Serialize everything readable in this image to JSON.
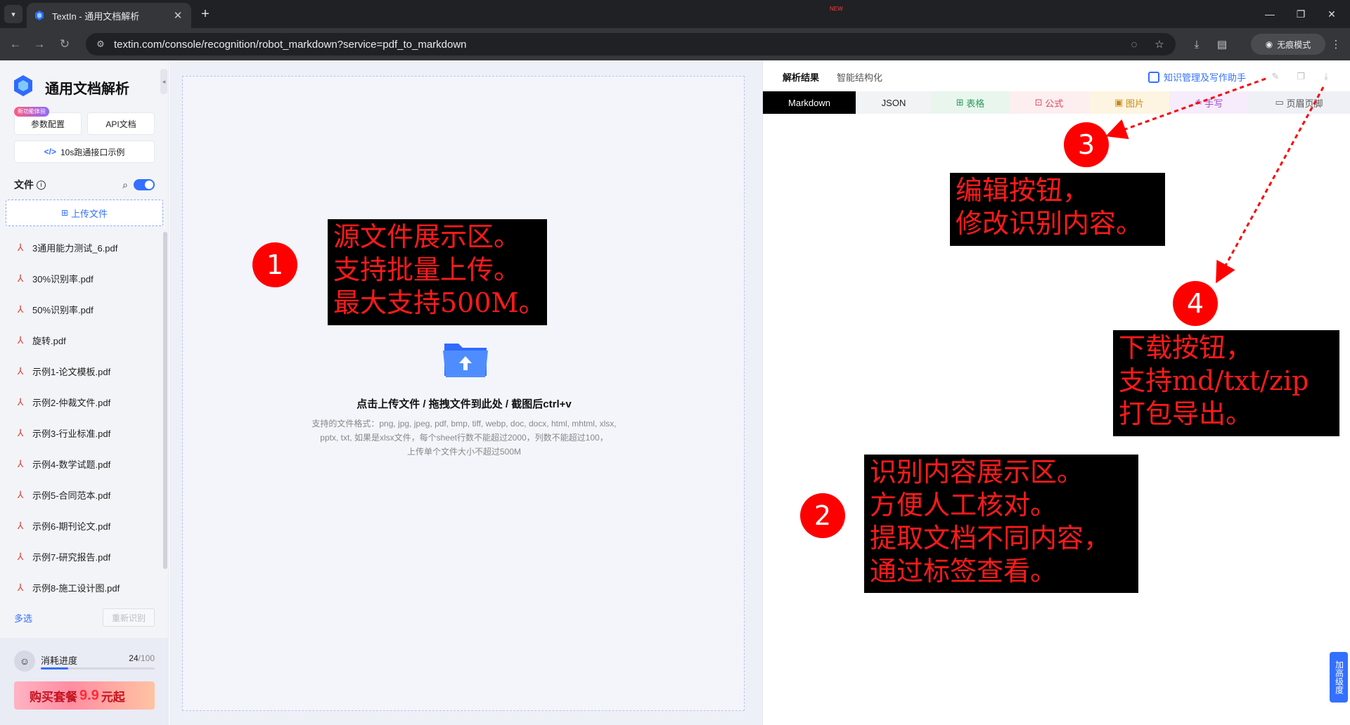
{
  "browser": {
    "tab_title": "TextIn - 通用文档解析",
    "url": "textin.com/console/recognition/robot_markdown?service=pdf_to_markdown",
    "incognito_label": "无痕模式"
  },
  "sidebar": {
    "title": "通用文档解析",
    "badge": "新功能体验",
    "params_btn": "参数配置",
    "api_btn": "API文档",
    "example_btn": "10s跑通接口示例",
    "files_label": "文件",
    "upload_btn": "上传文件",
    "files": [
      "3通用能力测试_6.pdf",
      "30%识别率.pdf",
      "50%识别率.pdf",
      "旋转.pdf",
      "示例1-论文模板.pdf",
      "示例2-仲裁文件.pdf",
      "示例3-行业标准.pdf",
      "示例4-数学试题.pdf",
      "示例5-合同范本.pdf",
      "示例6-期刊论文.pdf",
      "示例7-研究报告.pdf",
      "示例8-施工设计图.pdf"
    ],
    "multi_select": "多选",
    "reparse": "重新识别",
    "usage_label": "消耗进度",
    "usage_used": "24",
    "usage_total": "/100",
    "usage_fraction": 0.24,
    "promo_prefix": "购买套餐",
    "promo_price": "9.9",
    "promo_suffix": "元起"
  },
  "upload": {
    "title": "点击上传文件 / 拖拽文件到此处 / 截图后ctrl+v",
    "formats_line1": "支持的文件格式：png, jpg, jpeg, pdf, bmp, tiff, webp, doc, docx, html, mhtml, xlsx,",
    "formats_line2": "pptx, txt, 如果是xlsx文件，每个sheet行数不能超过2000，列数不能超过100，",
    "formats_line3": "上传单个文件大小不超过500M"
  },
  "result": {
    "tab_result": "解析结果",
    "tab_structured": "智能结构化",
    "new_badge": "NEW",
    "assistant": "知识管理及写作助手",
    "tabs": [
      {
        "label": "Markdown",
        "bg": "#000000",
        "color": "#ffffff"
      },
      {
        "label": "JSON",
        "bg": "#f2f3f5",
        "color": "#222222"
      },
      {
        "label": "表格",
        "bg": "#e8f6ee",
        "color": "#2c9a5a"
      },
      {
        "label": "公式",
        "bg": "#fdeef0",
        "color": "#e0465b"
      },
      {
        "label": "图片",
        "bg": "#fdf5e2",
        "color": "#c88a16"
      },
      {
        "label": "手写",
        "bg": "#f6ecfb",
        "color": "#a04bd0"
      },
      {
        "label": "页眉页脚",
        "bg": "#eef0f6",
        "color": "#555555"
      }
    ]
  },
  "annotations": {
    "n1": "1",
    "n2": "2",
    "n3": "3",
    "n4": "4",
    "box1_l1": "源文件展示区。",
    "box1_l2": "支持批量上传。",
    "box1_l3": "最大支持500M。",
    "box2_l1": "识别内容展示区。",
    "box2_l2": "方便人工核对。",
    "box2_l3": "提取文档不同内容，",
    "box2_l4": "通过标签查看。",
    "box3_l1": "编辑按钮，",
    "box3_l2": "修改识别内容。",
    "box4_l1": "下载按钮，",
    "box4_l2": "支持md/txt/zip",
    "box4_l3": "打包导出。"
  },
  "feedback_widget": "加高级度",
  "colors": {
    "accent": "#3370ff",
    "annotation_red": "#ff1a1a"
  }
}
